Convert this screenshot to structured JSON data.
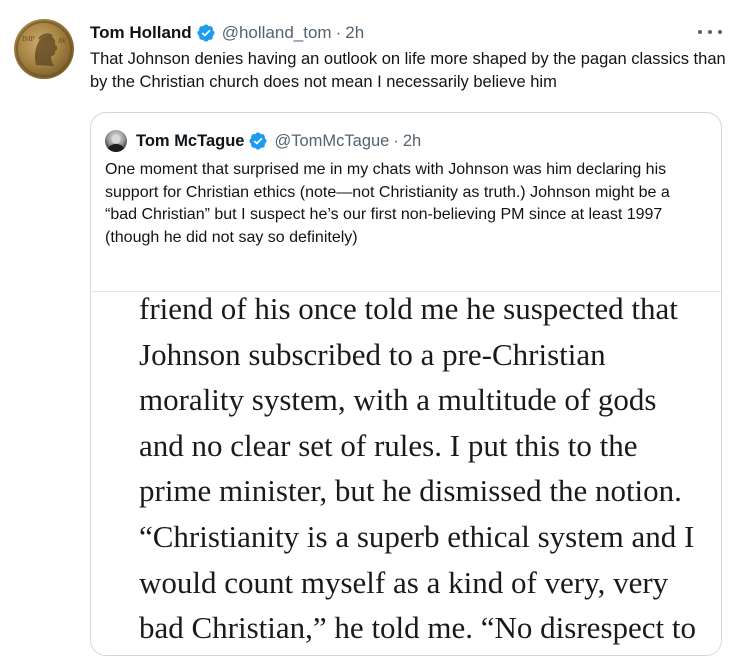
{
  "tweet": {
    "author_name": "Tom Holland",
    "author_handle": "@holland_tom",
    "separator": "·",
    "time": "2h",
    "text": "That Johnson denies having an outlook on life more shaped by the pagan classics than by the Christian church does not mean I necessarily believe him",
    "avatar_icon": "roman-coin-icon",
    "verified_color": "#1d9bf0"
  },
  "quote": {
    "author_name": "Tom McTague",
    "author_handle": "@TomMcTague",
    "separator": "·",
    "time": "2h",
    "text": "One moment that surprised me in my chats with Johnson was him declaring his support for Christian ethics (note—not Christianity as truth.) Johnson might be a “bad Christian” but I suspect he’s our first non-believing PM since at least 1997 (though he did not say so definitely)",
    "image_lines": [
      "friend of his once told me he suspected that",
      "Johnson subscribed to a pre-Christian",
      "morality system, with a multitude of gods",
      "and no clear set of rules. I put this to the",
      "prime minister, but he dismissed the notion.",
      "“Christianity is a superb ethical system and I",
      "would count myself as a kind of very, very",
      "bad Christian,” he told me. “No disrespect to"
    ]
  }
}
